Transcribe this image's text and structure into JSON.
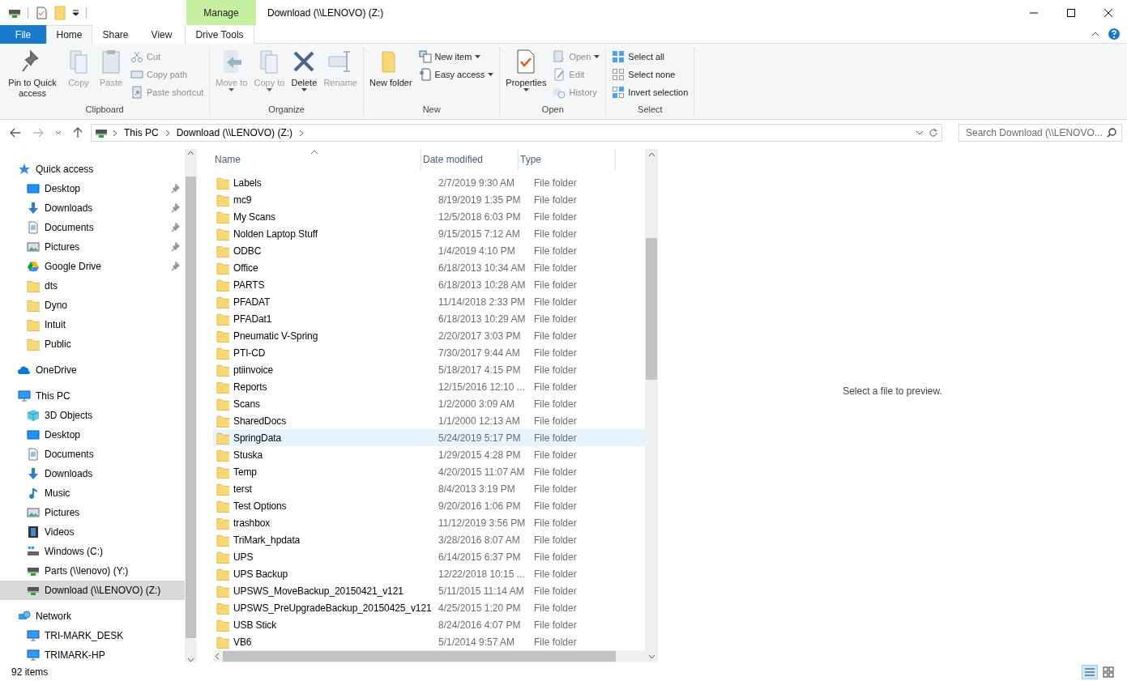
{
  "window": {
    "title": "Download (\\\\LENOVO) (Z:)",
    "context_tab": "Manage"
  },
  "tabs": [
    {
      "label": "File",
      "kind": "file",
      "selected": false
    },
    {
      "label": "Home",
      "kind": "tab",
      "selected": true
    },
    {
      "label": "Share",
      "kind": "tab",
      "selected": false
    },
    {
      "label": "View",
      "kind": "tab",
      "selected": false
    },
    {
      "label": "Drive Tools",
      "kind": "context",
      "selected": false
    }
  ],
  "ribbon": [
    {
      "name": "Clipboard",
      "large": [
        {
          "label": "Pin to Quick access",
          "kind": "pin",
          "disabled": false
        },
        {
          "label": "Copy",
          "kind": "copy",
          "disabled": true
        },
        {
          "label": "Paste",
          "kind": "paste",
          "disabled": true
        }
      ],
      "small": [
        {
          "label": "Cut",
          "kind": "cut",
          "disabled": true
        },
        {
          "label": "Copy path",
          "kind": "path",
          "disabled": true
        },
        {
          "label": "Paste shortcut",
          "kind": "shortcut",
          "disabled": true
        }
      ]
    },
    {
      "name": "Organize",
      "large": [
        {
          "label": "Move to",
          "kind": "move",
          "disabled": true,
          "dropdown": true
        },
        {
          "label": "Copy to",
          "kind": "copyto",
          "disabled": true,
          "dropdown": true
        },
        {
          "label": "Delete",
          "kind": "delete",
          "disabled": false,
          "dropdown": true
        },
        {
          "label": "Rename",
          "kind": "rename",
          "disabled": true
        }
      ]
    },
    {
      "name": "New",
      "large": [
        {
          "label": "New folder",
          "kind": "folder",
          "disabled": false
        }
      ],
      "small": [
        {
          "label": "New item",
          "kind": "newitem",
          "disabled": false,
          "dropdown": true
        },
        {
          "label": "Easy access",
          "kind": "easy",
          "disabled": false,
          "dropdown": true
        }
      ]
    },
    {
      "name": "Open",
      "large": [
        {
          "label": "Properties",
          "kind": "properties",
          "disabled": false,
          "dropdown": true
        }
      ],
      "small": [
        {
          "label": "Open",
          "kind": "open",
          "disabled": true,
          "dropdown": true
        },
        {
          "label": "Edit",
          "kind": "edit",
          "disabled": true
        },
        {
          "label": "History",
          "kind": "history",
          "disabled": true
        }
      ]
    },
    {
      "name": "Select",
      "small": [
        {
          "label": "Select all",
          "kind": "selall",
          "disabled": false
        },
        {
          "label": "Select none",
          "kind": "selnone",
          "disabled": false
        },
        {
          "label": "Invert selection",
          "kind": "invert",
          "disabled": false
        }
      ]
    }
  ],
  "address": {
    "crumbs": [
      "This PC",
      "Download (\\\\LENOVO) (Z:)"
    ],
    "search_placeholder": "Search Download (\\\\LENOVO..."
  },
  "sidebar": [
    {
      "label": "Quick access",
      "kind": "star",
      "selected": false,
      "children": [
        {
          "label": "Desktop",
          "kind": "desktop",
          "pinned": true,
          "selected": false
        },
        {
          "label": "Downloads",
          "kind": "download",
          "pinned": true,
          "selected": false
        },
        {
          "label": "Documents",
          "kind": "doc",
          "pinned": true,
          "selected": false
        },
        {
          "label": "Pictures",
          "kind": "pictures",
          "pinned": true,
          "selected": false
        },
        {
          "label": "Google Drive",
          "kind": "gdrive",
          "pinned": true,
          "selected": false
        },
        {
          "label": "dts",
          "kind": "folder",
          "pinned": false,
          "selected": false
        },
        {
          "label": "Dyno",
          "kind": "folder",
          "pinned": false,
          "selected": false
        },
        {
          "label": "Intuit",
          "kind": "folder",
          "pinned": false,
          "selected": false
        },
        {
          "label": "Public",
          "kind": "folder",
          "pinned": false,
          "selected": false
        }
      ]
    },
    {
      "label": "OneDrive",
      "kind": "cloud",
      "selected": false
    },
    {
      "label": "This PC",
      "kind": "pc",
      "selected": false,
      "children": [
        {
          "label": "3D Objects",
          "kind": "cube",
          "selected": false
        },
        {
          "label": "Desktop",
          "kind": "desktop",
          "selected": false
        },
        {
          "label": "Documents",
          "kind": "doc",
          "selected": false
        },
        {
          "label": "Downloads",
          "kind": "download",
          "selected": false
        },
        {
          "label": "Music",
          "kind": "music",
          "selected": false
        },
        {
          "label": "Pictures",
          "kind": "pictures",
          "selected": false
        },
        {
          "label": "Videos",
          "kind": "video",
          "selected": false
        },
        {
          "label": "Windows (C:)",
          "kind": "drive",
          "selected": false
        },
        {
          "label": "Parts (\\\\lenovo) (Y:)",
          "kind": "netdrive",
          "selected": false
        },
        {
          "label": "Download (\\\\LENOVO) (Z:)",
          "kind": "netdrive",
          "selected": true
        }
      ]
    },
    {
      "label": "Network",
      "kind": "network",
      "selected": false,
      "children": [
        {
          "label": "TRI-MARK_DESK",
          "kind": "pc",
          "selected": false
        },
        {
          "label": "TRIMARK-HP",
          "kind": "pc",
          "selected": false
        }
      ]
    }
  ],
  "table": {
    "columns": [
      "Name",
      "Date modified",
      "Type"
    ],
    "rows": [
      {
        "name": "Labels",
        "date": "2/7/2019 9:30 AM",
        "type": "File folder",
        "selected": false
      },
      {
        "name": "mc9",
        "date": "8/19/2019 1:35 PM",
        "type": "File folder",
        "selected": false
      },
      {
        "name": "My Scans",
        "date": "12/5/2018 6:03 PM",
        "type": "File folder",
        "selected": false
      },
      {
        "name": "Nolden Laptop Stuff",
        "date": "9/15/2015 7:12 AM",
        "type": "File folder",
        "selected": false
      },
      {
        "name": "ODBC",
        "date": "1/4/2019 4:10 PM",
        "type": "File folder",
        "selected": false
      },
      {
        "name": "Office",
        "date": "6/18/2013 10:34 AM",
        "type": "File folder",
        "selected": false
      },
      {
        "name": "PARTS",
        "date": "6/18/2013 10:28 AM",
        "type": "File folder",
        "selected": false
      },
      {
        "name": "PFADAT",
        "date": "11/14/2018 2:33 PM",
        "type": "File folder",
        "selected": false
      },
      {
        "name": "PFADat1",
        "date": "6/18/2013 10:29 AM",
        "type": "File folder",
        "selected": false
      },
      {
        "name": "Pneumatic V-Spring",
        "date": "2/20/2017 3:03 PM",
        "type": "File folder",
        "selected": false
      },
      {
        "name": "PTI-CD",
        "date": "7/30/2017 9:44 AM",
        "type": "File folder",
        "selected": false
      },
      {
        "name": "ptiinvoice",
        "date": "5/18/2017 4:15 PM",
        "type": "File folder",
        "selected": false
      },
      {
        "name": "Reports",
        "date": "12/15/2016 12:10 ...",
        "type": "File folder",
        "selected": false
      },
      {
        "name": "Scans",
        "date": "1/2/2000 3:09 AM",
        "type": "File folder",
        "selected": false
      },
      {
        "name": "SharedDocs",
        "date": "1/1/2000 12:13 AM",
        "type": "File folder",
        "selected": false
      },
      {
        "name": "SpringData",
        "date": "5/24/2019 5:17 PM",
        "type": "File folder",
        "selected": true
      },
      {
        "name": "Stuska",
        "date": "1/29/2015 4:28 PM",
        "type": "File folder",
        "selected": false
      },
      {
        "name": "Temp",
        "date": "4/20/2015 11:07 AM",
        "type": "File folder",
        "selected": false
      },
      {
        "name": "terst",
        "date": "8/4/2013 3:19 PM",
        "type": "File folder",
        "selected": false
      },
      {
        "name": "Test Options",
        "date": "9/20/2016 1:06 PM",
        "type": "File folder",
        "selected": false
      },
      {
        "name": "trashbox",
        "date": "11/12/2019 3:56 PM",
        "type": "File folder",
        "selected": false
      },
      {
        "name": "TriMark_hpdata",
        "date": "3/28/2016 8:07 AM",
        "type": "File folder",
        "selected": false
      },
      {
        "name": "UPS",
        "date": "6/14/2015 6:37 PM",
        "type": "File folder",
        "selected": false
      },
      {
        "name": "UPS Backup",
        "date": "12/22/2018 10:15 ...",
        "type": "File folder",
        "selected": false
      },
      {
        "name": "UPSWS_MoveBackup_20150421_v121",
        "date": "5/11/2015 11:14 AM",
        "type": "File folder",
        "selected": false
      },
      {
        "name": "UPSWS_PreUpgradeBackup_20150425_v121",
        "date": "4/25/2015 1:20 PM",
        "type": "File folder",
        "selected": false
      },
      {
        "name": "USB Stick",
        "date": "8/24/2016 4:07 PM",
        "type": "File folder",
        "selected": false
      },
      {
        "name": "VB6",
        "date": "5/1/2014 9:57 AM",
        "type": "File folder",
        "selected": false
      }
    ]
  },
  "preview": {
    "message": "Select a file to preview."
  },
  "status_bar": {
    "count": "92 items"
  }
}
